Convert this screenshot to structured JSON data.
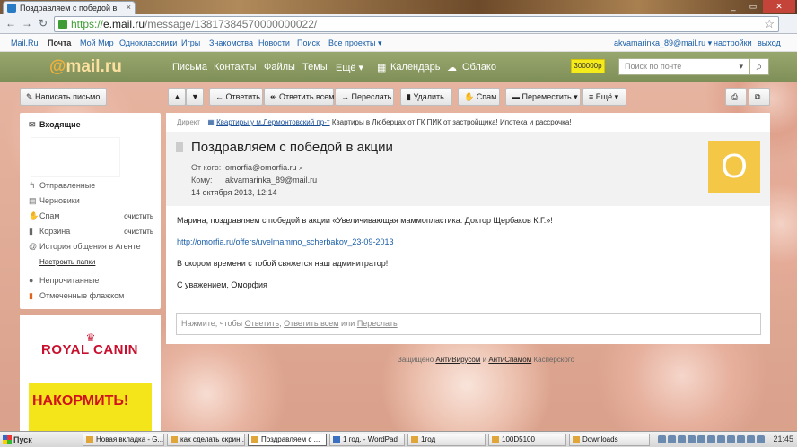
{
  "browser": {
    "tab_title": "Поздравляем с победой в",
    "url_scheme": "https://",
    "url_host": "e.mail.ru",
    "url_path": "/message/13817384570000000022/"
  },
  "portal_nav": {
    "items": [
      "Mail.Ru",
      "Почта",
      "Мой Мир",
      "Одноклассники",
      "Игры",
      "Знакомства",
      "Новости",
      "Поиск",
      "Все проекты ▾"
    ],
    "user": "akvamarinka_89@mail.ru ▾",
    "settings": "настройки",
    "logout": "выход"
  },
  "header": {
    "logo_at": "@",
    "logo_text": "mail.ru",
    "nav": [
      "Письма",
      "Контакты",
      "Файлы",
      "Темы",
      "Ещё ▾"
    ],
    "calendar": "Календарь",
    "cloud": "Облако",
    "badge": "300000р",
    "search_placeholder": "Поиск по почте"
  },
  "toolbar": {
    "compose": "Написать письмо",
    "reply": "Ответить",
    "reply_all": "Ответить всем",
    "forward": "Переслать",
    "delete": "Удалить",
    "spam": "Спам",
    "move": "Переместить ▾",
    "more": "Ещё ▾"
  },
  "sidebar": {
    "inbox": "Входящие",
    "sent": "Отправленные",
    "drafts": "Черновики",
    "spam": "Спам",
    "trash": "Корзина",
    "clear": "очистить",
    "agent_history": "История общения в Агенте",
    "configure": "Настроить папки",
    "unread": "Непрочитанные",
    "flagged": "Отмеченные флажком"
  },
  "ad": {
    "brand": "ROYAL CANIN",
    "slogan": "НАКОРМИТЬ!"
  },
  "direct_ad": {
    "label": "Директ",
    "link": "Квартиры у м.Лермонтовский пр-т",
    "text": "Квартиры в Люберцах от ГК ПИК от застройщика! Ипотека и рассрочка!"
  },
  "message": {
    "subject": "Поздравляем с победой в акции",
    "from_label": "От кого:",
    "from": "omorfia@omorfia.ru",
    "to_label": "Кому:",
    "to": "akvamarinka_89@mail.ru",
    "date": "14 октября 2013, 12:14",
    "avatar_letter": "O",
    "line1": "Марина, поздравляем с победой в акции «Увеличивающая маммопластика. Доктор Щербаков К.Г.»!",
    "link": "http://omorfia.ru/offers/uvelmammo_scherbakov_23-09-2013",
    "line2": "В скором времени с тобой свяжется наш админитратор!",
    "line3": "С уважением, Оморфия",
    "reply_prefix": "Нажмите, чтобы",
    "reply_link1": "Ответить",
    "reply_link2": "Ответить всем",
    "reply_or": "или",
    "reply_link3": "Переслать"
  },
  "footer": {
    "prefix": "Защищено",
    "av": "АнтиВирусом",
    "and": "и",
    "as": "АнтиСпамом",
    "suffix": "Касперского"
  },
  "taskbar": {
    "start": "Пуск",
    "items": [
      "Новая вкладка - G...",
      "как сделать скрин...",
      "Поздравляем с ...",
      "1 год. - WordPad",
      "1год",
      "100D5100",
      "Downloads"
    ],
    "clock": "21:45"
  }
}
